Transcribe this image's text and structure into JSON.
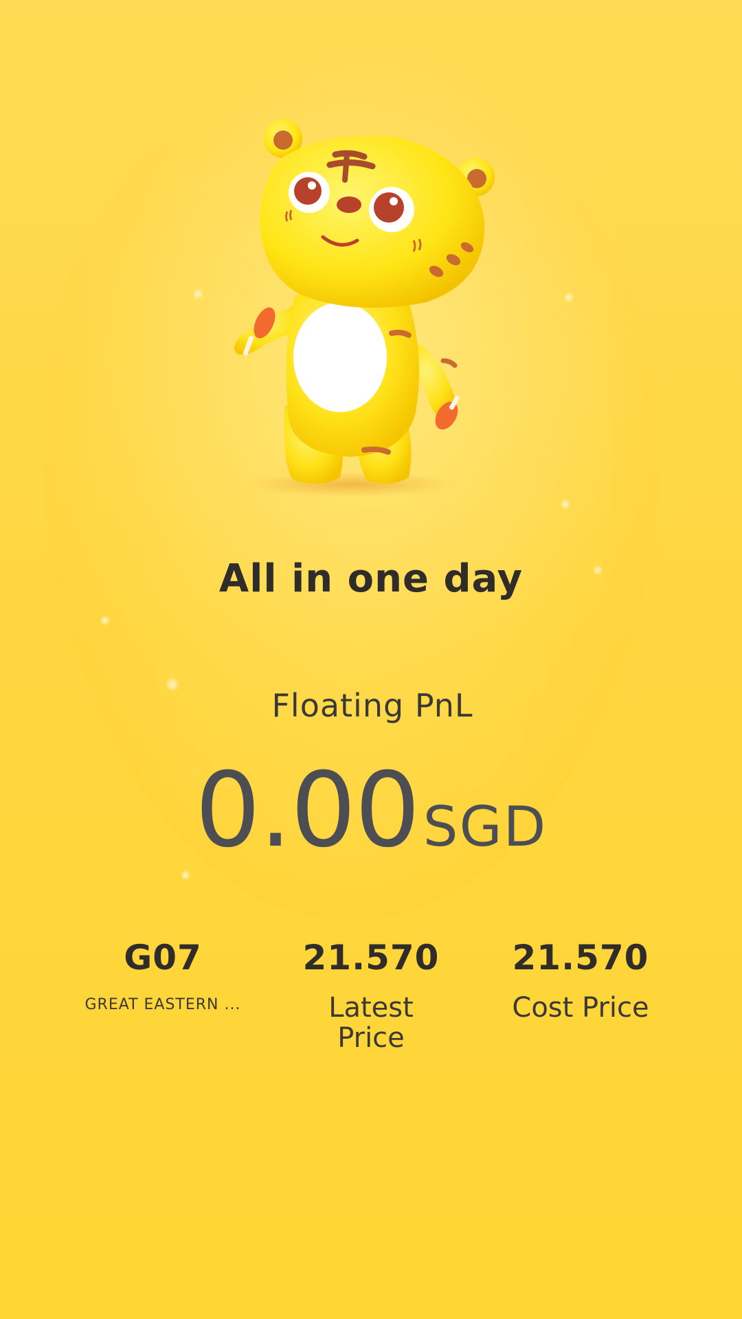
{
  "headline": "All in one day",
  "pnl": {
    "label": "Floating PnL",
    "amount": "0.00",
    "currency": "SGD"
  },
  "stats": [
    {
      "value": "G07",
      "label": "GREAT EASTERN ..."
    },
    {
      "value": "21.570",
      "label": "Latest Price"
    },
    {
      "value": "21.570",
      "label": "Cost Price"
    }
  ],
  "mascot": {
    "icon": "tiger-mascot-icon"
  },
  "colors": {
    "background": "#FFD43A",
    "text_dark": "#2F2C2A",
    "value_gray": "#4C4E54"
  }
}
